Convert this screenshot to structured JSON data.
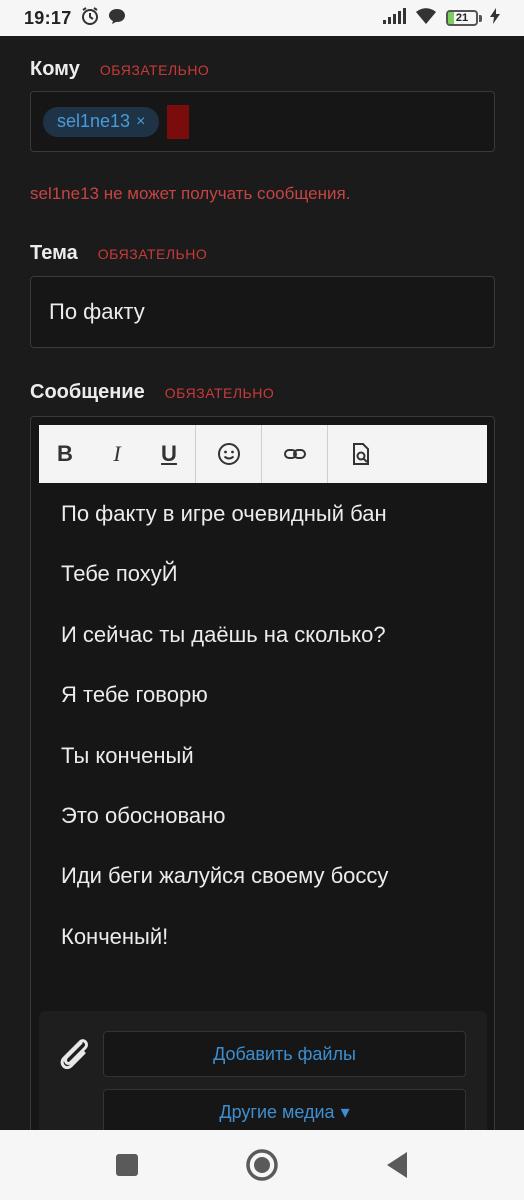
{
  "status_bar": {
    "time": "19:17",
    "battery_level": "21",
    "battery_fraction": 0.21
  },
  "to_field": {
    "label": "Кому",
    "required": "ОБЯЗАТЕЛЬНО",
    "recipients": [
      {
        "name": "sel1ne13",
        "remove": "×"
      }
    ],
    "error": "sel1ne13 не может получать сообщения."
  },
  "subject_field": {
    "label": "Тема",
    "required": "ОБЯЗАТЕЛЬНО",
    "value": "По факту"
  },
  "message_field": {
    "label": "Сообщение",
    "required": "ОБЯЗАТЕЛЬНО",
    "toolbar": {
      "bold": "B",
      "italic": "I",
      "underline": "U",
      "icons": [
        "smiley-icon",
        "link-icon",
        "preview-icon"
      ]
    },
    "lines": [
      "По факту в игре очевидный бан",
      "Тебе похуЙ",
      "И сейчас ты даёшь на сколько?",
      "Я тебе говорю",
      "Ты конченый",
      "Это обосновано",
      "Иди беги жалуйся своему боссу",
      "Конченый!"
    ]
  },
  "attachments": {
    "add_files": "Добавить файлы",
    "other_media": "Другие медиа",
    "dropdown_glyph": "▾"
  },
  "colors": {
    "background": "#1b1b1b",
    "required_red": "#c83a3a",
    "link_blue": "#3d8fd1",
    "tag_bg": "#1f3347"
  }
}
